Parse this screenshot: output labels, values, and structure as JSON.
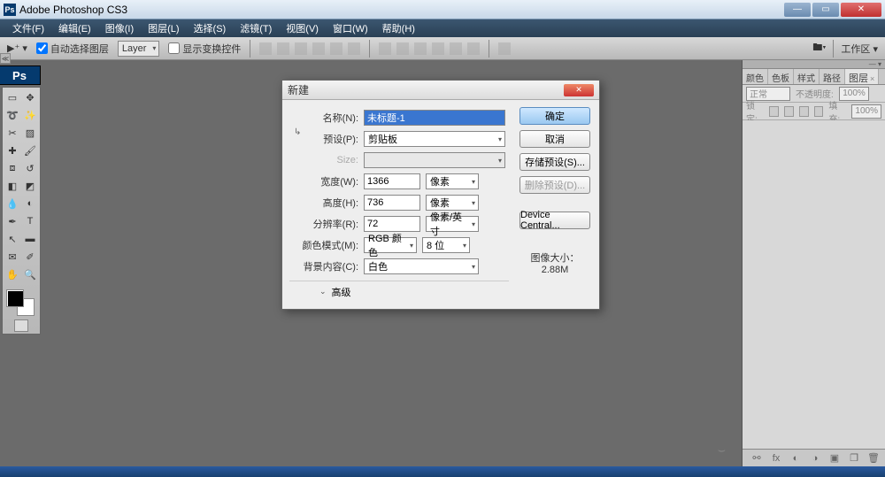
{
  "window": {
    "title": "Adobe Photoshop CS3"
  },
  "menu": {
    "items": [
      "文件(F)",
      "编辑(E)",
      "图像(I)",
      "图层(L)",
      "选择(S)",
      "滤镜(T)",
      "视图(V)",
      "窗口(W)",
      "帮助(H)"
    ]
  },
  "options": {
    "auto_select": "自动选择图层",
    "layer_combo": "Layer",
    "show_transform": "显示变换控件",
    "workspace": "工作区 ▾"
  },
  "panels": {
    "tabs": [
      "颜色",
      "色板",
      "样式",
      "路径",
      "图层"
    ],
    "active_tab": 4,
    "blend_mode": "正常",
    "opacity_label": "不透明度:",
    "opacity_value": "100%",
    "lock_label": "锁定:",
    "fill_label": "填充:",
    "fill_value": "100%"
  },
  "dialog": {
    "title": "新建",
    "labels": {
      "name": "名称(N):",
      "preset": "预设(P):",
      "size": "Size:",
      "width": "宽度(W):",
      "height": "高度(H):",
      "resolution": "分辨率(R):",
      "color_mode": "颜色模式(M):",
      "bg": "背景内容(C):",
      "advanced": "高级"
    },
    "values": {
      "name": "未标题-1",
      "preset": "剪贴板",
      "width": "1366",
      "height": "736",
      "resolution": "72",
      "mode": "RGB 颜色",
      "bits": "8 位",
      "bg": "白色"
    },
    "units": {
      "px": "像素",
      "ppi": "像素/英寸"
    },
    "buttons": {
      "ok": "确定",
      "cancel": "取消",
      "save_preset": "存储预设(S)...",
      "delete_preset": "删除预设(D)...",
      "device_central": "Device Central..."
    },
    "size_label": "图像大小：",
    "size_value": "2.88M"
  }
}
